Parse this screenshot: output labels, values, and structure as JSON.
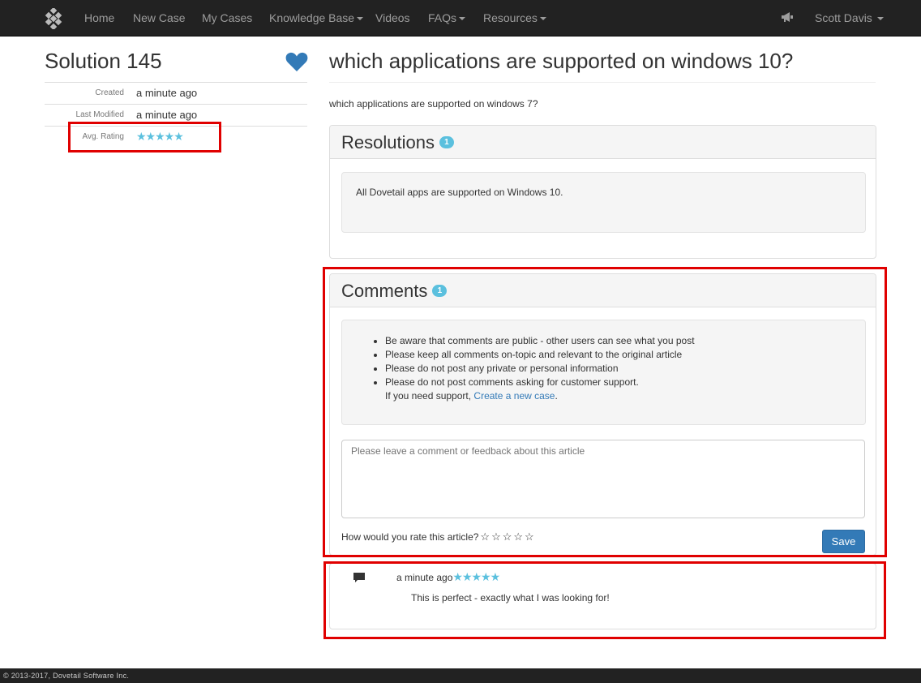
{
  "navbar": {
    "logo_icon": "dovetail-logo-icon",
    "items": [
      {
        "label": "Home"
      },
      {
        "label": "New Case"
      },
      {
        "label": "My Cases"
      },
      {
        "label": "Knowledge Base"
      },
      {
        "label": "Videos"
      },
      {
        "label": "FAQs"
      },
      {
        "label": "Resources"
      }
    ],
    "announce_icon": "megaphone-icon",
    "user": "Scott Davis"
  },
  "solution": {
    "title": "Solution 145",
    "favorite_icon": "heart-icon",
    "meta": [
      {
        "label": "Created",
        "value": "a minute ago"
      },
      {
        "label": "Last Modified",
        "value": "a minute ago"
      },
      {
        "label": "Avg. Rating",
        "stars": "★★★★★"
      }
    ]
  },
  "question": {
    "title": "which applications are supported on windows 10?",
    "body": "which applications are supported on windows 7?"
  },
  "resolutions": {
    "title": "Resolutions",
    "count": "1",
    "text": "All Dovetail apps are supported on Windows 10."
  },
  "comments": {
    "title": "Comments",
    "count": "1",
    "rules": [
      "Be aware that comments are public - other users can see what you post",
      "Please keep all comments on-topic and relevant to the original article",
      "Please do not post any private or personal information",
      "Please do not post comments asking for customer support."
    ],
    "support_prefix": "If you need support, ",
    "support_link": "Create a new case",
    "support_suffix": ".",
    "placeholder": "Please leave a comment or feedback about this article",
    "rate_label": "How would you rate this article?",
    "rate_stars": "☆☆☆☆☆",
    "save_label": "Save",
    "items": [
      {
        "time": "a minute ago",
        "stars": "★★★★★",
        "text": "This is perfect - exactly what I was looking for!",
        "icon": "comment-icon"
      }
    ]
  },
  "footer": {
    "text": "© 2013-2017, Dovetail Software Inc."
  },
  "colors": {
    "accent": "#337ab7",
    "badge": "#5bc0de",
    "highlight": "#e00000",
    "navbar": "#222222"
  }
}
